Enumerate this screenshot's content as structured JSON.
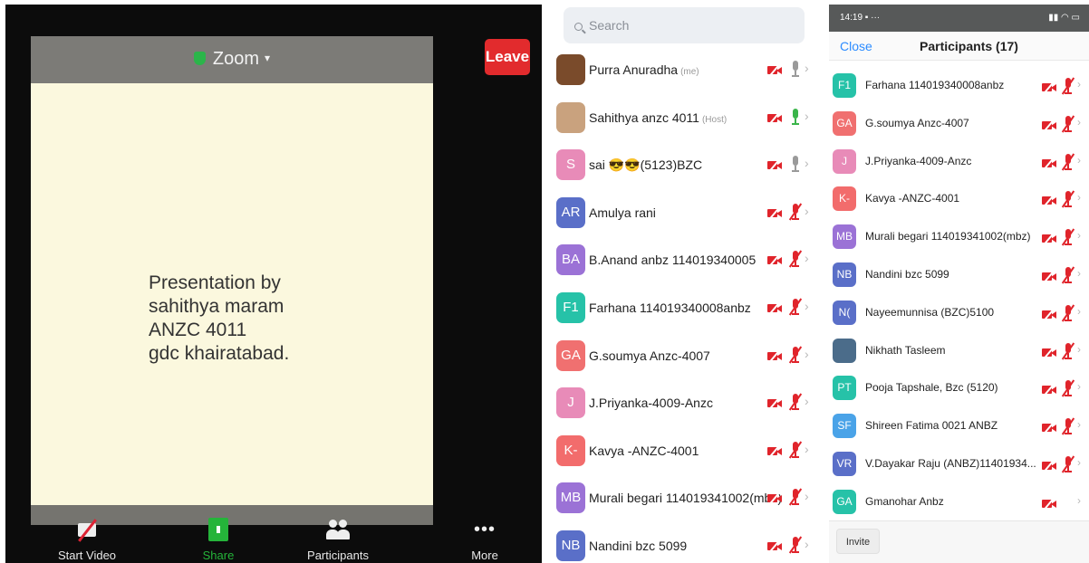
{
  "meeting": {
    "title": "Zoom",
    "leave_label": "Leave",
    "slide_lines": [
      "Presentation by",
      "sahithya maram",
      "ANZC 4011",
      "gdc khairatabad."
    ],
    "toolbar": [
      {
        "label": "Start Video",
        "icon": "video-off-icon"
      },
      {
        "label": "Share",
        "icon": "share-icon"
      },
      {
        "label": "Participants",
        "icon": "participants-icon"
      },
      {
        "label": "More",
        "icon": "more-icon"
      }
    ]
  },
  "participants_panel": {
    "search_placeholder": "Search",
    "rows": [
      {
        "initials": "",
        "name": "Purra Anuradha",
        "tag": "(me)",
        "avatar_color": "#7a4b2b",
        "mic": "gray"
      },
      {
        "initials": "",
        "name": "Sahithya anzc 4011",
        "tag": "(Host)",
        "avatar_color": "#c9a27e",
        "mic": "green"
      },
      {
        "initials": "S",
        "name": "sai 😎😎(5123)BZC",
        "tag": "",
        "avatar_color": "#e88bb8",
        "mic": "gray"
      },
      {
        "initials": "AR",
        "name": "Amulya rani",
        "tag": "",
        "avatar_color": "#5a6fc8",
        "mic": "red"
      },
      {
        "initials": "BA",
        "name": "B.Anand anbz 114019340005",
        "tag": "",
        "avatar_color": "#9b72d6",
        "mic": "red"
      },
      {
        "initials": "F1",
        "name": "Farhana 114019340008anbz",
        "tag": "",
        "avatar_color": "#26c2a8",
        "mic": "red"
      },
      {
        "initials": "GA",
        "name": "G.soumya Anzc-4007",
        "tag": "",
        "avatar_color": "#f07070",
        "mic": "red"
      },
      {
        "initials": "J",
        "name": "J.Priyanka-4009-Anzc",
        "tag": "",
        "avatar_color": "#e88bb8",
        "mic": "red"
      },
      {
        "initials": "K-",
        "name": "Kavya -ANZC-4001",
        "tag": "",
        "avatar_color": "#f26c6c",
        "mic": "red"
      },
      {
        "initials": "MB",
        "name": "Murali begari 114019341002(mbz)",
        "tag": "",
        "avatar_color": "#9b72d6",
        "mic": "red"
      },
      {
        "initials": "NB",
        "name": "Nandini bzc 5099",
        "tag": "",
        "avatar_color": "#5a6fc8",
        "mic": "red"
      }
    ]
  },
  "phone_panel": {
    "time": "14:19",
    "close_label": "Close",
    "title": "Participants (17)",
    "invite_label": "Invite",
    "rows": [
      {
        "initials": "F1",
        "name": "Farhana 114019340008anbz",
        "avatar_color": "#26c2a8",
        "mic": "red"
      },
      {
        "initials": "GA",
        "name": "G.soumya Anzc-4007",
        "avatar_color": "#f07070",
        "mic": "red"
      },
      {
        "initials": "J",
        "name": "J.Priyanka-4009-Anzc",
        "avatar_color": "#e88bb8",
        "mic": "red"
      },
      {
        "initials": "K-",
        "name": "Kavya -ANZC-4001",
        "avatar_color": "#f26c6c",
        "mic": "red"
      },
      {
        "initials": "MB",
        "name": "Murali begari 114019341002(mbz)",
        "avatar_color": "#9b72d6",
        "mic": "red"
      },
      {
        "initials": "NB",
        "name": "Nandini bzc 5099",
        "avatar_color": "#5a6fc8",
        "mic": "red"
      },
      {
        "initials": "N(",
        "name": "Nayeemunnisa (BZC)5100",
        "avatar_color": "#5a6fc8",
        "mic": "red"
      },
      {
        "initials": "",
        "name": "Nikhath Tasleem",
        "avatar_color": "#4b6c8a",
        "mic": "red"
      },
      {
        "initials": "PT",
        "name": "Pooja Tapshale, Bzc (5120)",
        "avatar_color": "#26c2a8",
        "mic": "red"
      },
      {
        "initials": "SF",
        "name": "Shireen Fatima 0021 ANBZ",
        "avatar_color": "#4aa3e8",
        "mic": "red"
      },
      {
        "initials": "VR",
        "name": "V.Dayakar Raju (ANBZ)11401934...",
        "avatar_color": "#5a6fc8",
        "mic": "red"
      },
      {
        "initials": "GA",
        "name": "Gmanohar Anbz",
        "avatar_color": "#26c2a8",
        "mic": "none"
      }
    ]
  }
}
